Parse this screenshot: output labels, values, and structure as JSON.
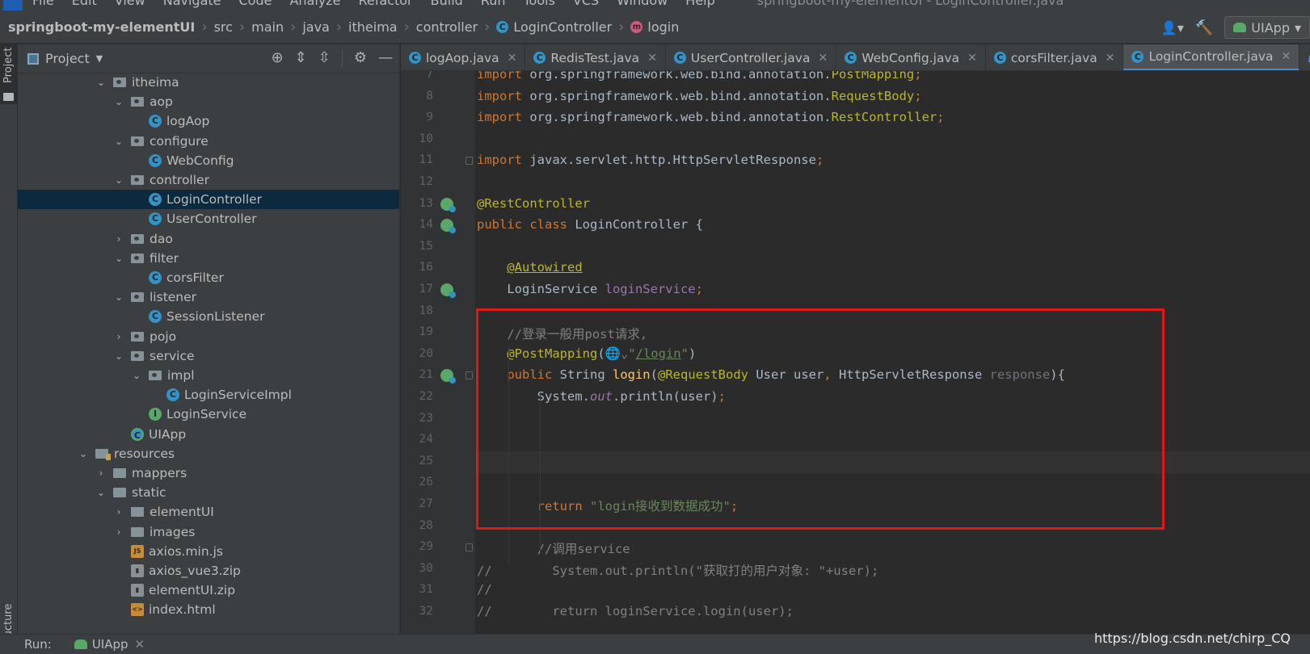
{
  "menubar": {
    "items": [
      "File",
      "Edit",
      "View",
      "Navigate",
      "Code",
      "Analyze",
      "Refactor",
      "Build",
      "Run",
      "Tools",
      "VCS",
      "Window",
      "Help"
    ],
    "window_title": "springboot-my-elementUI - LoginController.java"
  },
  "breadcrumb": {
    "items": [
      "springboot-my-elementUI",
      "src",
      "main",
      "java",
      "itheima",
      "controller",
      "LoginController",
      "login"
    ]
  },
  "toolbar": {
    "run_config": "UIApp"
  },
  "left_stripe": {
    "project_label": "Project",
    "structure_label": "Structure"
  },
  "project_panel": {
    "title": "Project",
    "tree": [
      {
        "label": "itheima",
        "depth": 0,
        "kind": "folder-pkg",
        "expanded": true
      },
      {
        "label": "aop",
        "depth": 1,
        "kind": "folder-pkg",
        "expanded": true
      },
      {
        "label": "logAop",
        "depth": 2,
        "kind": "class"
      },
      {
        "label": "configure",
        "depth": 1,
        "kind": "folder-pkg",
        "expanded": true
      },
      {
        "label": "WebConfig",
        "depth": 2,
        "kind": "class"
      },
      {
        "label": "controller",
        "depth": 1,
        "kind": "folder-pkg",
        "expanded": true
      },
      {
        "label": "LoginController",
        "depth": 2,
        "kind": "class",
        "selected": true
      },
      {
        "label": "UserController",
        "depth": 2,
        "kind": "class"
      },
      {
        "label": "dao",
        "depth": 1,
        "kind": "folder-pkg",
        "expanded": false
      },
      {
        "label": "filter",
        "depth": 1,
        "kind": "folder-pkg",
        "expanded": true
      },
      {
        "label": "corsFilter",
        "depth": 2,
        "kind": "class"
      },
      {
        "label": "listener",
        "depth": 1,
        "kind": "folder-pkg",
        "expanded": true
      },
      {
        "label": "SessionListener",
        "depth": 2,
        "kind": "class"
      },
      {
        "label": "pojo",
        "depth": 1,
        "kind": "folder-pkg",
        "expanded": false
      },
      {
        "label": "service",
        "depth": 1,
        "kind": "folder-pkg",
        "expanded": true
      },
      {
        "label": "impl",
        "depth": 2,
        "kind": "folder-pkg",
        "expanded": true
      },
      {
        "label": "LoginServiceImpl",
        "depth": 3,
        "kind": "class"
      },
      {
        "label": "LoginService",
        "depth": 2,
        "kind": "interface"
      },
      {
        "label": "UIApp",
        "depth": 1,
        "kind": "app"
      },
      {
        "label": "resources",
        "depth": -1,
        "kind": "folder-res",
        "expanded": true
      },
      {
        "label": "mappers",
        "depth": 0,
        "kind": "folder",
        "expanded": false
      },
      {
        "label": "static",
        "depth": 0,
        "kind": "folder",
        "expanded": true
      },
      {
        "label": "elementUI",
        "depth": 1,
        "kind": "folder",
        "expanded": false
      },
      {
        "label": "images",
        "depth": 1,
        "kind": "folder",
        "expanded": false
      },
      {
        "label": "axios.min.js",
        "depth": 1,
        "kind": "js"
      },
      {
        "label": "axios_vue3.zip",
        "depth": 1,
        "kind": "zip"
      },
      {
        "label": "elementUI.zip",
        "depth": 1,
        "kind": "zip"
      },
      {
        "label": "index.html",
        "depth": 1,
        "kind": "html"
      }
    ]
  },
  "tabs": [
    {
      "label": "logAop.java",
      "icon": "class-icon",
      "active": false
    },
    {
      "label": "RedisTest.java",
      "icon": "test-class-icon",
      "active": false
    },
    {
      "label": "UserController.java",
      "icon": "class-icon",
      "active": false
    },
    {
      "label": "WebConfig.java",
      "icon": "class-icon",
      "active": false
    },
    {
      "label": "corsFilter.java",
      "icon": "class-icon",
      "active": false
    },
    {
      "label": "LoginController.java",
      "icon": "class-icon",
      "active": true
    }
  ],
  "editor": {
    "current_line": 25,
    "lines": [
      {
        "n": 7,
        "tokens": [
          [
            "kw",
            "import "
          ],
          [
            "",
            "org.springframework.web.bind.annotation."
          ],
          [
            "ann",
            "PostMapping"
          ],
          [
            "kw",
            ";"
          ]
        ]
      },
      {
        "n": 8,
        "tokens": [
          [
            "kw",
            "import "
          ],
          [
            "",
            "org.springframework.web.bind.annotation."
          ],
          [
            "ann",
            "RequestBody"
          ],
          [
            "kw",
            ";"
          ]
        ]
      },
      {
        "n": 9,
        "tokens": [
          [
            "kw",
            "import "
          ],
          [
            "",
            "org.springframework.web.bind.annotation."
          ],
          [
            "ann",
            "RestController"
          ],
          [
            "kw",
            ";"
          ]
        ]
      },
      {
        "n": 10,
        "tokens": []
      },
      {
        "n": 11,
        "tokens": [
          [
            "kw",
            "import "
          ],
          [
            "",
            "javax.servlet.http.HttpServletResponse"
          ],
          [
            "kw",
            ";"
          ]
        ]
      },
      {
        "n": 12,
        "tokens": []
      },
      {
        "n": 13,
        "tokens": [
          [
            "ann",
            "@RestController"
          ]
        ]
      },
      {
        "n": 14,
        "tokens": [
          [
            "kw",
            "public class "
          ],
          [
            "",
            "LoginController {"
          ]
        ]
      },
      {
        "n": 15,
        "tokens": []
      },
      {
        "n": 16,
        "tokens": [
          [
            "",
            "    "
          ],
          [
            "ann ul",
            "@Autowired"
          ]
        ]
      },
      {
        "n": 17,
        "tokens": [
          [
            "",
            "    LoginService "
          ],
          [
            "fld",
            "loginService"
          ],
          [
            "kw",
            ";"
          ]
        ]
      },
      {
        "n": 18,
        "tokens": []
      },
      {
        "n": 19,
        "tokens": [
          [
            "cmt",
            "    //登录一般用post请求,"
          ]
        ]
      },
      {
        "n": 20,
        "tokens": [
          [
            "",
            "    "
          ],
          [
            "ann",
            "@PostMapping"
          ],
          [
            "",
            "("
          ],
          [
            "cmt",
            "🌐⌄"
          ],
          [
            "str",
            "\""
          ],
          [
            "str ul",
            "/login"
          ],
          [
            "str",
            "\""
          ],
          [
            "",
            ")"
          ]
        ]
      },
      {
        "n": 21,
        "tokens": [
          [
            "",
            "    "
          ],
          [
            "kw",
            "public "
          ],
          [
            "",
            "String "
          ],
          [
            "fn",
            "login"
          ],
          [
            "",
            "("
          ],
          [
            "ann",
            "@RequestBody "
          ],
          [
            "",
            "User user"
          ],
          [
            "kw",
            ", "
          ],
          [
            "",
            "HttpServletResponse "
          ],
          [
            "param-unused",
            "response"
          ],
          [
            "",
            "){"
          ]
        ]
      },
      {
        "n": 22,
        "tokens": [
          [
            "",
            "        System."
          ],
          [
            "fld it",
            "out"
          ],
          [
            "",
            ".println(user)"
          ],
          [
            "kw",
            ";"
          ]
        ]
      },
      {
        "n": 23,
        "tokens": []
      },
      {
        "n": 24,
        "tokens": []
      },
      {
        "n": 25,
        "tokens": []
      },
      {
        "n": 26,
        "tokens": []
      },
      {
        "n": 27,
        "tokens": [
          [
            "",
            "        "
          ],
          [
            "kw",
            "return "
          ],
          [
            "str",
            "\"login接收到数据成功\""
          ],
          [
            "kw",
            ";"
          ]
        ]
      },
      {
        "n": 28,
        "tokens": []
      },
      {
        "n": 29,
        "tokens": [
          [
            "cmt",
            "        //调用service"
          ]
        ]
      },
      {
        "n": 30,
        "tokens": [
          [
            "cmt",
            "//        System.out.println(\"获取打的用户对象: \"+user);"
          ]
        ]
      },
      {
        "n": 31,
        "tokens": [
          [
            "cmt",
            "//"
          ]
        ]
      },
      {
        "n": 32,
        "tokens": [
          [
            "cmt",
            "//        return loginService.login(user);"
          ]
        ]
      }
    ]
  },
  "runbar": {
    "label": "Run:",
    "tab": "UIApp"
  },
  "watermark": "https://blog.csdn.net/chirp_CQ"
}
